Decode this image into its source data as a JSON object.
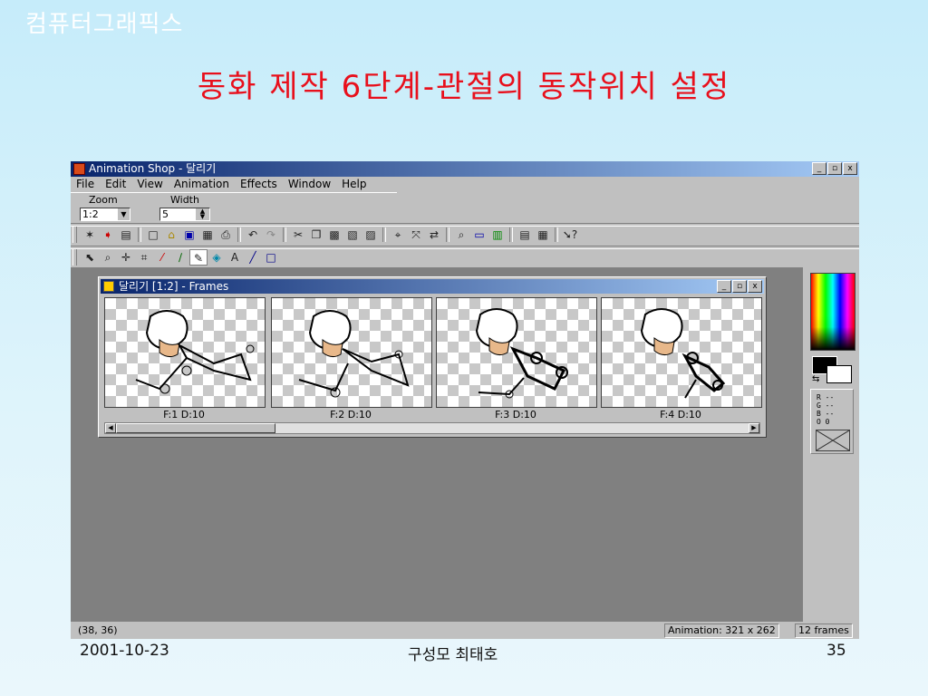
{
  "slide": {
    "corner_title": "컴퓨터그래픽스",
    "title": "동화 제작 6단계-관절의 동작위치 설정",
    "footer_date": "2001-10-23",
    "footer_author": "구성모 최태호",
    "footer_page": "35"
  },
  "app": {
    "title": "Animation Shop - 달리기",
    "caption_buttons": [
      "_",
      "▫",
      "x"
    ],
    "menu": [
      "File",
      "Edit",
      "View",
      "Animation",
      "Effects",
      "Window",
      "Help"
    ],
    "zoom_label": "Zoom",
    "zoom_value": "1:2",
    "width_label": "Width",
    "width_value": "5",
    "status_coords": "(38, 36)",
    "status_animation": "Animation: 321 x 262",
    "status_frames": "12 frames",
    "rgb_lines": [
      "R --",
      "G --",
      "B --",
      "O 0"
    ]
  },
  "frames_window": {
    "title": "달리기 [1:2] - Frames",
    "frames": [
      {
        "label": "F:1   D:10"
      },
      {
        "label": "F:2   D:10"
      },
      {
        "label": "F:3   D:10"
      },
      {
        "label": "F:4   D:10"
      }
    ]
  },
  "icons": {
    "toolbar1": [
      "wizard-icon",
      "arrow-icon",
      "banner-icon",
      "new-icon",
      "open-icon",
      "save-icon",
      "properties-icon",
      "print-icon",
      "undo-icon",
      "redo-icon",
      "cut-icon",
      "copy-icon",
      "paste-icon",
      "paste-new-icon",
      "paste-frame-icon",
      "crop-icon",
      "resize-icon",
      "replace-icon",
      "zoom-icon",
      "filmstrip-icon",
      "color-bars-icon",
      "view-frames-icon",
      "view-animation-icon",
      "help-icon"
    ],
    "toolbar2": [
      "arrow-select-icon",
      "magnifier-icon",
      "mover-icon",
      "crop-tool-icon",
      "dropper-icon",
      "paintbrush-icon",
      "eraser-icon",
      "fill-icon",
      "text-icon",
      "line-icon",
      "rectangle-icon"
    ]
  }
}
